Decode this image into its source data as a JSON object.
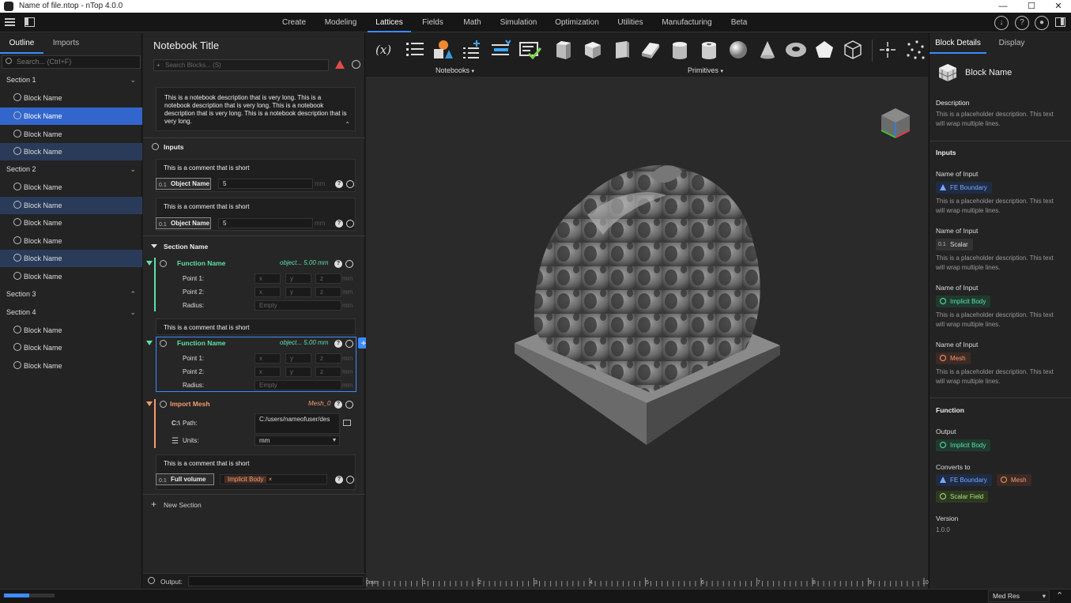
{
  "window": {
    "title": "Name of file.ntop - nTop 4.0.0",
    "min": "—",
    "max": "☐",
    "close": "✕"
  },
  "menu": [
    "Create",
    "Modeling",
    "Lattices",
    "Fields",
    "Math",
    "Simulation",
    "Optimization",
    "Utilities",
    "Manufacturing",
    "Beta"
  ],
  "left": {
    "tabs": [
      "Outline",
      "Imports"
    ],
    "search_placeholder": "Search... (Ctrl+F)",
    "sections": [
      {
        "label": "Section 1",
        "items": [
          "Block Name",
          "Block Name",
          "Block Name",
          "Block Name"
        ]
      },
      {
        "label": "Section 2",
        "items": [
          "Block Name",
          "Block Name",
          "Block Name",
          "Block Name",
          "Block Name",
          "Block Name"
        ]
      },
      {
        "label": "Section 3",
        "items": []
      },
      {
        "label": "Section 4",
        "items": [
          "Block Name",
          "Block Name",
          "Block Name"
        ]
      }
    ]
  },
  "notebook": {
    "title": "Notebook Title",
    "search_placeholder": "Search Blocks... (S)",
    "description": "This is a notebook description that is very long. This is a notebook description that is very long. This is a notebook description that is very long. This is a notebook description that is very long.",
    "inputs_label": "Inputs",
    "comment": "This is a comment that is short",
    "object_tag": "0.1",
    "object_name": "Object Name",
    "value": "5",
    "unit": "mm",
    "help": "?",
    "section_name": "Section Name",
    "function_name": "Function Name",
    "fn_summary": "object... 5.00 mm",
    "point1": "Point 1:",
    "point2": "Point 2:",
    "radius": "Radius:",
    "ph_x": "x",
    "ph_y": "y",
    "ph_z": "z",
    "ph_empty": "Empty",
    "import_mesh": "Import Mesh",
    "mesh_summary": "Mesh_0",
    "path_tag": "C:\\",
    "path_label": "Path:",
    "path_value": "C:/users/nameofuser/des",
    "units_label": "Units:",
    "units_value": "mm",
    "full_volume": "Full volume",
    "implicit_body": "Implicit Body",
    "new_section": "New Section",
    "output_label": "Output:"
  },
  "toolbar": {
    "notebooks": "Notebooks",
    "primitives": "Primitives",
    "fx": "(x)"
  },
  "right": {
    "tabs": [
      "Block Details",
      "Display"
    ],
    "block_name": "Block Name",
    "description_label": "Description",
    "placeholder_desc": "This is a placeholder description.  This text will wrap multiple lines.",
    "inputs_label": "Inputs",
    "input_name": "Name of Input",
    "chips": {
      "fe": "FE Boundary",
      "scalar": "Scalar",
      "implicit": "Implicit Body",
      "mesh": "Mesh",
      "scalar_field": "Scalar Field"
    },
    "function_label": "Function",
    "output_label": "Output",
    "converts_label": "Converts to",
    "version_label": "Version",
    "version": "1.0.0"
  },
  "ruler": {
    "ticks": [
      "0mm",
      "1",
      "2",
      "3",
      "4",
      "5",
      "6",
      "7",
      "8",
      "9",
      "10"
    ]
  },
  "status": {
    "resolution": "Med Res",
    "progress": 0.5
  },
  "colors": {
    "accent": "#3d8bfd",
    "function": "#5fe0a8",
    "mesh": "#f59a6e",
    "fe": "#7aa7ff",
    "implicit": "#5fe0a8",
    "scalar_field": "#a8e07a"
  }
}
